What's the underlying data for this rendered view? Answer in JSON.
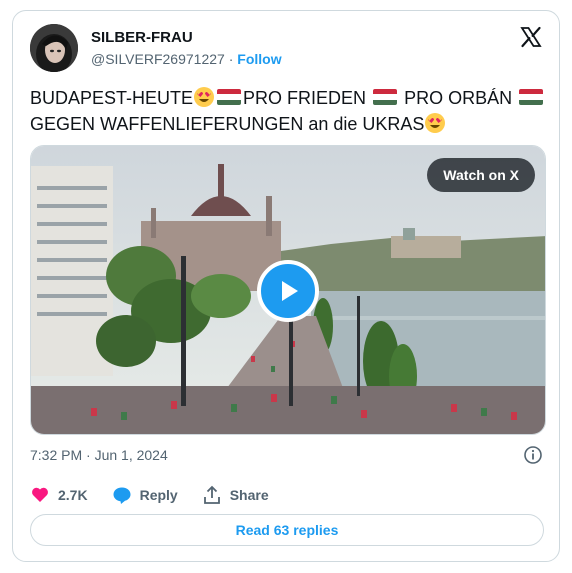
{
  "author": {
    "name": "SILBER-FRAU",
    "handle": "@SILVERF26971227",
    "separator": "·",
    "follow_label": "Follow"
  },
  "tweet": {
    "parts": [
      "BUDAPEST-HEUTE",
      "PRO FRIEDEN",
      "PRO ORBÁN",
      "GEGEN WAFFENLIEFERUNGEN an die UKRAS"
    ],
    "flag_colors": [
      "#cd2a3e",
      "#ffffff",
      "#436f4d"
    ]
  },
  "media": {
    "watch_label": "Watch on X",
    "play_icon": "play-icon"
  },
  "timestamp": "7:32 PM · Jun 1, 2024",
  "actions": {
    "likes": "2.7K",
    "reply_label": "Reply",
    "share_label": "Share"
  },
  "read_replies_label": "Read 63 replies",
  "colors": {
    "accent": "#1d9bf0",
    "like": "#f91880",
    "text": "#0f1419",
    "muted": "#536471"
  }
}
